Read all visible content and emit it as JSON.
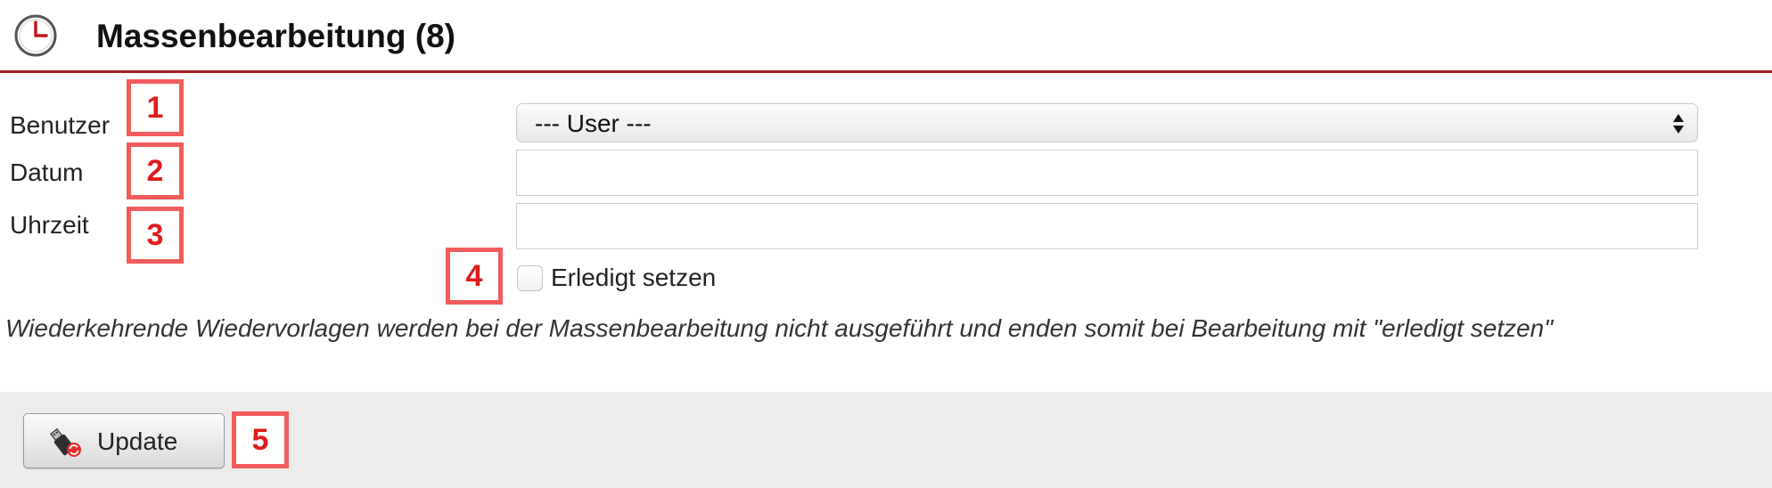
{
  "header": {
    "title": "Massenbearbeitung (8)",
    "icon": "clock-icon",
    "accent_color": "#a61c1c"
  },
  "form": {
    "user_label": "Benutzer",
    "user_select": {
      "selected": "--- User ---"
    },
    "date_label": "Datum",
    "date_value": "",
    "time_label": "Uhrzeit",
    "time_value": "",
    "done_checkbox": {
      "label": "Erledigt setzen",
      "checked": false
    }
  },
  "notice": "Wiederkehrende Wiedervorlagen werden bei der Massenbearbeitung nicht ausgeführt und enden somit bei Bearbeitung mit \"erledigt setzen\"",
  "footer": {
    "update_label": "Update",
    "update_icon": "usb-refresh-icon"
  },
  "annotations": {
    "marker_color": "#f25c5c",
    "markers": [
      "1",
      "2",
      "3",
      "4",
      "5"
    ]
  }
}
